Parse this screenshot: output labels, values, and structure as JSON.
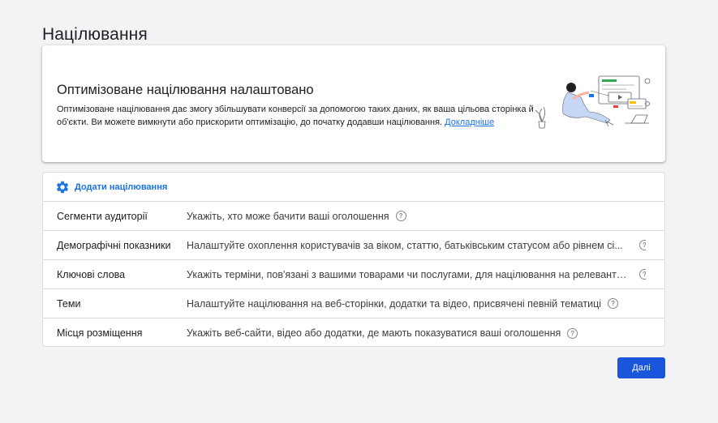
{
  "page": {
    "title": "Націлювання"
  },
  "banner": {
    "title": "Оптимізоване націлювання налаштовано",
    "description": "Оптимізоване націлювання дає змогу збільшувати конверсії за допомогою таких даних, як ваша цільова сторінка й об'єкти. Ви можете вимкнути або прискорити оптимізацію, до початку додавши націлювання.",
    "link": "Докладніше",
    "illustration_icon": "person-with-laptop-illustration"
  },
  "targeting": {
    "add_label": "Додати націлювання",
    "rows": [
      {
        "name": "Сегменти аудиторії",
        "description": "Укажіть, хто може бачити ваші оголошення"
      },
      {
        "name": "Демографічні показники",
        "description": "Налаштуйте охоплення користувачів за віком, статтю, батьківським статусом або рівнем сі..."
      },
      {
        "name": "Ключові слова",
        "description": "Укажіть терміни, пов'язані з вашими товарами чи послугами, для націлювання на релевантні..."
      },
      {
        "name": "Теми",
        "description": "Налаштуйте націлювання на веб-сторінки, додатки та відео, присвячені певній тематиці"
      },
      {
        "name": "Місця розміщення",
        "description": "Укажіть веб-сайти, відео або додатки, де мають показуватися ваші оголошення"
      }
    ]
  },
  "actions": {
    "next_label": "Далі"
  },
  "colors": {
    "accent": "#1a73e8",
    "button": "#1a56db",
    "background": "#f1f3f4"
  }
}
